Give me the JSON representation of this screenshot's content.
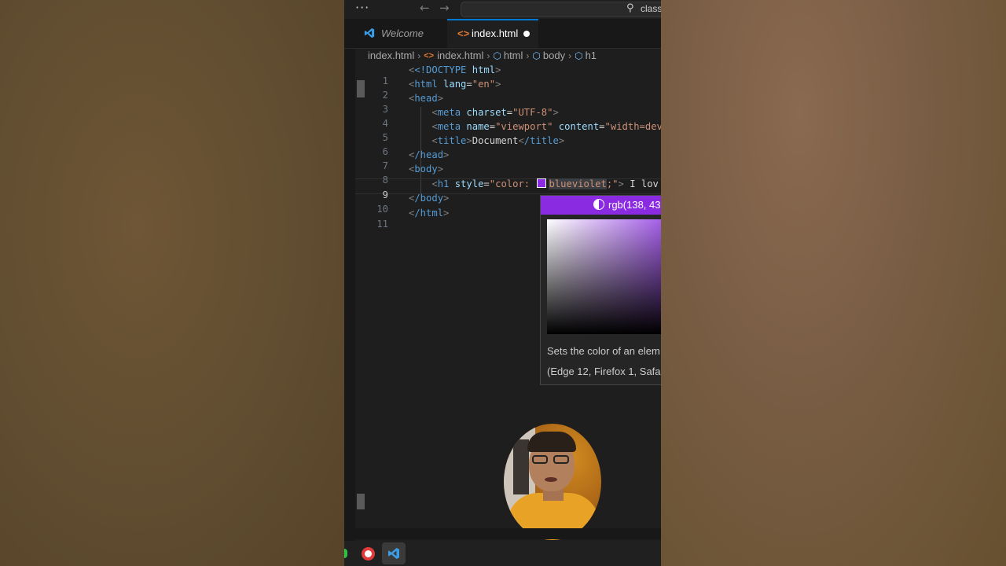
{
  "titlebar": {
    "menu": "···",
    "back": "←",
    "forward": "→",
    "search_text": "class"
  },
  "tabs": [
    {
      "label": "Welcome"
    },
    {
      "label": "index.html"
    }
  ],
  "breadcrumb": [
    "index.html",
    "index.html",
    "html",
    "body",
    "h1"
  ],
  "editor": {
    "lines": [
      {
        "n": "1"
      },
      {
        "n": "2"
      },
      {
        "n": "3"
      },
      {
        "n": "4"
      },
      {
        "n": "5"
      },
      {
        "n": "6"
      },
      {
        "n": "7"
      },
      {
        "n": "8"
      },
      {
        "n": "9"
      },
      {
        "n": "10"
      },
      {
        "n": "11"
      }
    ],
    "code": {
      "l1_doctype": "<!DOCTYPE",
      "l1_html": " html",
      "l1_close": ">",
      "l2_tag": "html",
      "l2_attr": " lang",
      "l2_val": "\"en\"",
      "l3_tag": "head",
      "l4_tag": "meta",
      "l4_attr": " charset",
      "l4_val": "\"UTF-8\"",
      "l5_tag": "meta",
      "l5_attr1": " name",
      "l5_val1": "\"viewport\"",
      "l5_attr2": " content",
      "l5_val2": "\"width=dev",
      "l6_tag": "title",
      "l6_text": "Document",
      "l6_close": "/title",
      "l7_tag": "/head",
      "l8_tag": "body",
      "l9_tag": "h1",
      "l9_attr": " style",
      "l9_val_open": "\"color: ",
      "l9_color": "blueviolet",
      "l9_val_close": ";\"",
      "l9_text": " I lov",
      "l10_tag": "/body",
      "l11_tag": "/html"
    }
  },
  "color_picker": {
    "color": "#8a2be2",
    "rgb_text": "rgb(138, 43",
    "description": "Sets the color of an elem",
    "compat": "(Edge 12, Firefox 1, Safari"
  },
  "accent_color": "#0078d4"
}
